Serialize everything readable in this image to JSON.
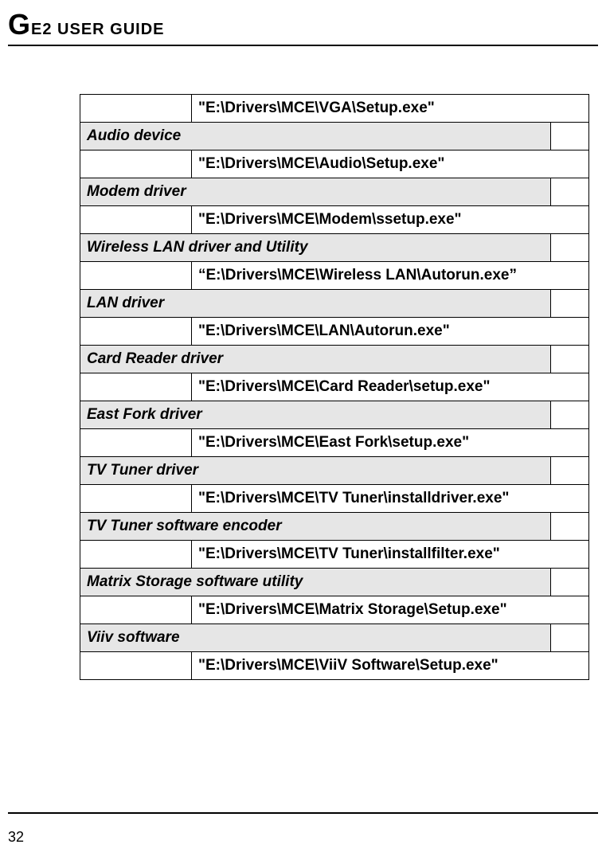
{
  "header": {
    "title_prefix": "G",
    "title_rest": "E2 USER GUIDE"
  },
  "rows": [
    {
      "type": "path",
      "text": "\"E:\\Drivers\\MCE\\VGA\\Setup.exe\""
    },
    {
      "type": "label",
      "text": "Audio device",
      "wide": false
    },
    {
      "type": "path",
      "text": "\"E:\\Drivers\\MCE\\Audio\\Setup.exe\""
    },
    {
      "type": "label",
      "text": "Modem driver",
      "wide": false
    },
    {
      "type": "path",
      "text": "\"E:\\Drivers\\MCE\\Modem\\ssetup.exe\""
    },
    {
      "type": "label",
      "text": "Wireless LAN driver and Utility",
      "wide": true
    },
    {
      "type": "path",
      "text": "“E:\\Drivers\\MCE\\Wireless LAN\\Autorun.exe”"
    },
    {
      "type": "label",
      "text": "LAN driver",
      "wide": false
    },
    {
      "type": "path",
      "text": "\"E:\\Drivers\\MCE\\LAN\\Autorun.exe\""
    },
    {
      "type": "label",
      "text": "Card Reader driver",
      "wide": false
    },
    {
      "type": "path",
      "text": "\"E:\\Drivers\\MCE\\Card Reader\\setup.exe\""
    },
    {
      "type": "label",
      "text": "East Fork driver",
      "wide": false
    },
    {
      "type": "path",
      "text": "\"E:\\Drivers\\MCE\\East Fork\\setup.exe\""
    },
    {
      "type": "label",
      "text": "TV Tuner driver",
      "wide": false
    },
    {
      "type": "path",
      "text": "\"E:\\Drivers\\MCE\\TV Tuner\\installdriver.exe\""
    },
    {
      "type": "label",
      "text": "TV Tuner software encoder",
      "wide": true
    },
    {
      "type": "path",
      "text": "\"E:\\Drivers\\MCE\\TV Tuner\\installfilter.exe\""
    },
    {
      "type": "label",
      "text": "Matrix Storage software utility",
      "wide": true
    },
    {
      "type": "path",
      "text": "\"E:\\Drivers\\MCE\\Matrix Storage\\Setup.exe\""
    },
    {
      "type": "label",
      "text": "Viiv software",
      "wide": false
    },
    {
      "type": "path",
      "text": "\"E:\\Drivers\\MCE\\ViiV Software\\Setup.exe\""
    }
  ],
  "page_number": "32"
}
